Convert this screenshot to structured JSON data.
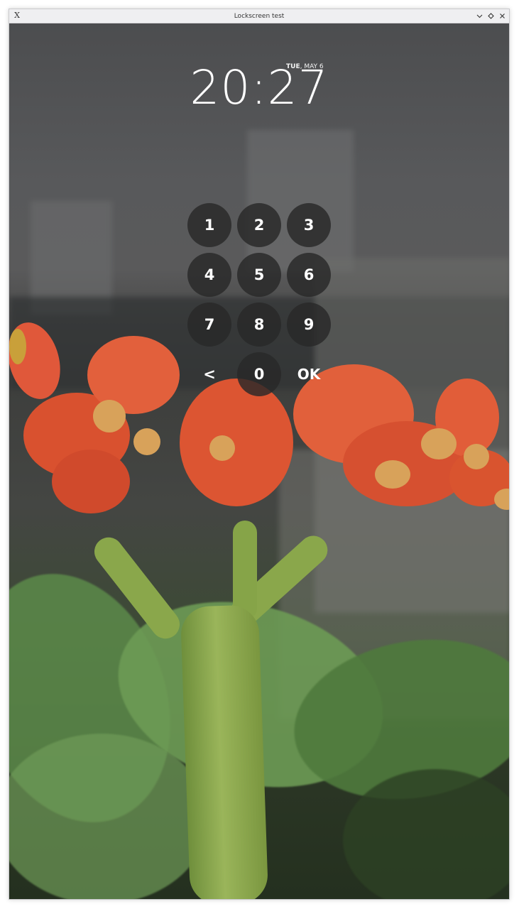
{
  "window": {
    "title": "Lockscreen test",
    "app_icon": "X",
    "controls": [
      "minimize-icon",
      "maximize-icon",
      "close-icon"
    ]
  },
  "lockscreen": {
    "date_day": "TUE",
    "date_rest": ", MAY 6",
    "time": "20:27",
    "keys": [
      "1",
      "2",
      "3",
      "4",
      "5",
      "6",
      "7",
      "8",
      "9",
      "<",
      "0",
      "OK"
    ]
  },
  "colors": {
    "key_background": "#282828",
    "text": "#ffffff"
  }
}
